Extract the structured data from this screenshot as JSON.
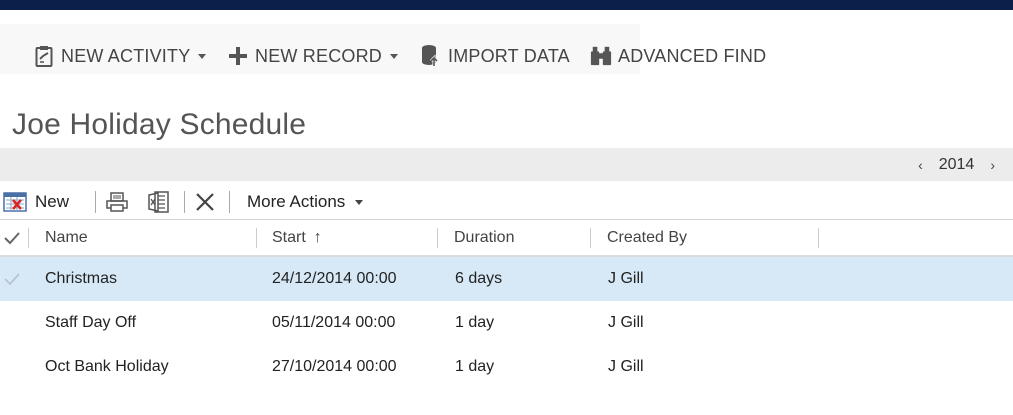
{
  "commands": {
    "new_activity": "NEW ACTIVITY",
    "new_record": "NEW RECORD",
    "import_data": "IMPORT DATA",
    "advanced_find": "ADVANCED FIND"
  },
  "page": {
    "title": "Joe Holiday Schedule"
  },
  "year_nav": {
    "year": "2014",
    "prev": "‹",
    "next": "›"
  },
  "toolbar": {
    "new_label": "New",
    "more_actions_label": "More Actions"
  },
  "grid": {
    "columns": [
      "Name",
      "Start",
      "Duration",
      "Created By"
    ],
    "sort_indicator": "↑",
    "rows": [
      {
        "name": "Christmas",
        "start": "24/12/2014 00:00",
        "duration": "6 days",
        "created_by": "J Gill",
        "selected": true
      },
      {
        "name": "Staff Day Off",
        "start": "05/11/2014 00:00",
        "duration": "1 day",
        "created_by": "J Gill",
        "selected": false
      },
      {
        "name": "Oct Bank Holiday",
        "start": "27/10/2014 00:00",
        "duration": "1 day",
        "created_by": "J Gill",
        "selected": false
      }
    ]
  },
  "colors": {
    "topbar": "#0b1f4b",
    "selected_row": "#d7e9f7",
    "year_bar": "#ececec"
  }
}
